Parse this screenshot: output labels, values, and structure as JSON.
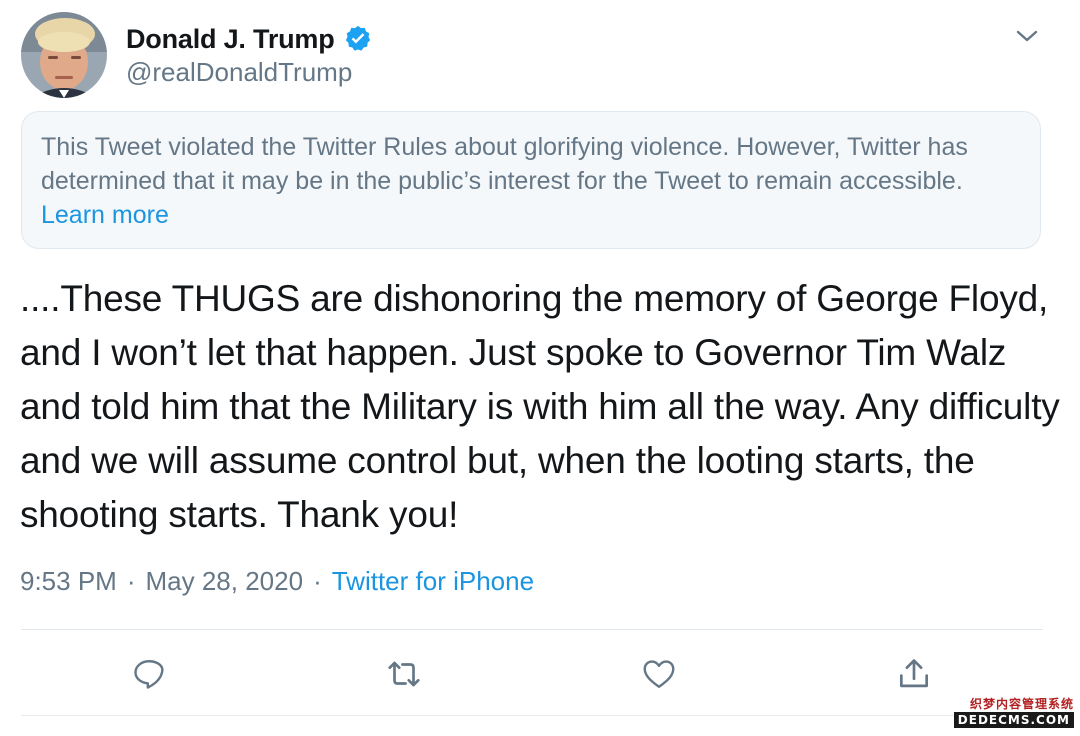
{
  "user": {
    "display_name": "Donald J. Trump",
    "handle": "@realDonaldTrump",
    "verified": true
  },
  "notice": {
    "text": "This Tweet violated the Twitter Rules about glorifying violence. However, Twitter has determined that it may be in the public’s interest for the Tweet to remain accessible.",
    "link_label": "Learn more"
  },
  "tweet": {
    "text": "....These THUGS are dishonoring the memory of George Floyd, and I won’t let that happen. Just spoke to Governor Tim Walz and told him that the Military is with him all the way. Any difficulty and we will assume control but, when the looting starts, the shooting starts. Thank you!",
    "time": "9:53 PM",
    "separator": "·",
    "date": "May 28, 2020",
    "source": "Twitter for iPhone"
  },
  "actions": {
    "reply_icon": "reply-icon",
    "retweet_icon": "retweet-icon",
    "like_icon": "like-icon",
    "share_icon": "share-icon"
  },
  "watermark": {
    "top": "织梦内容管理系统",
    "bottom": "DEDECMS.COM"
  },
  "colors": {
    "text": "#14171a",
    "secondary": "#657786",
    "accent": "#1b95e0",
    "notice_bg": "#f5f8fa",
    "border": "#e1e8ed"
  }
}
